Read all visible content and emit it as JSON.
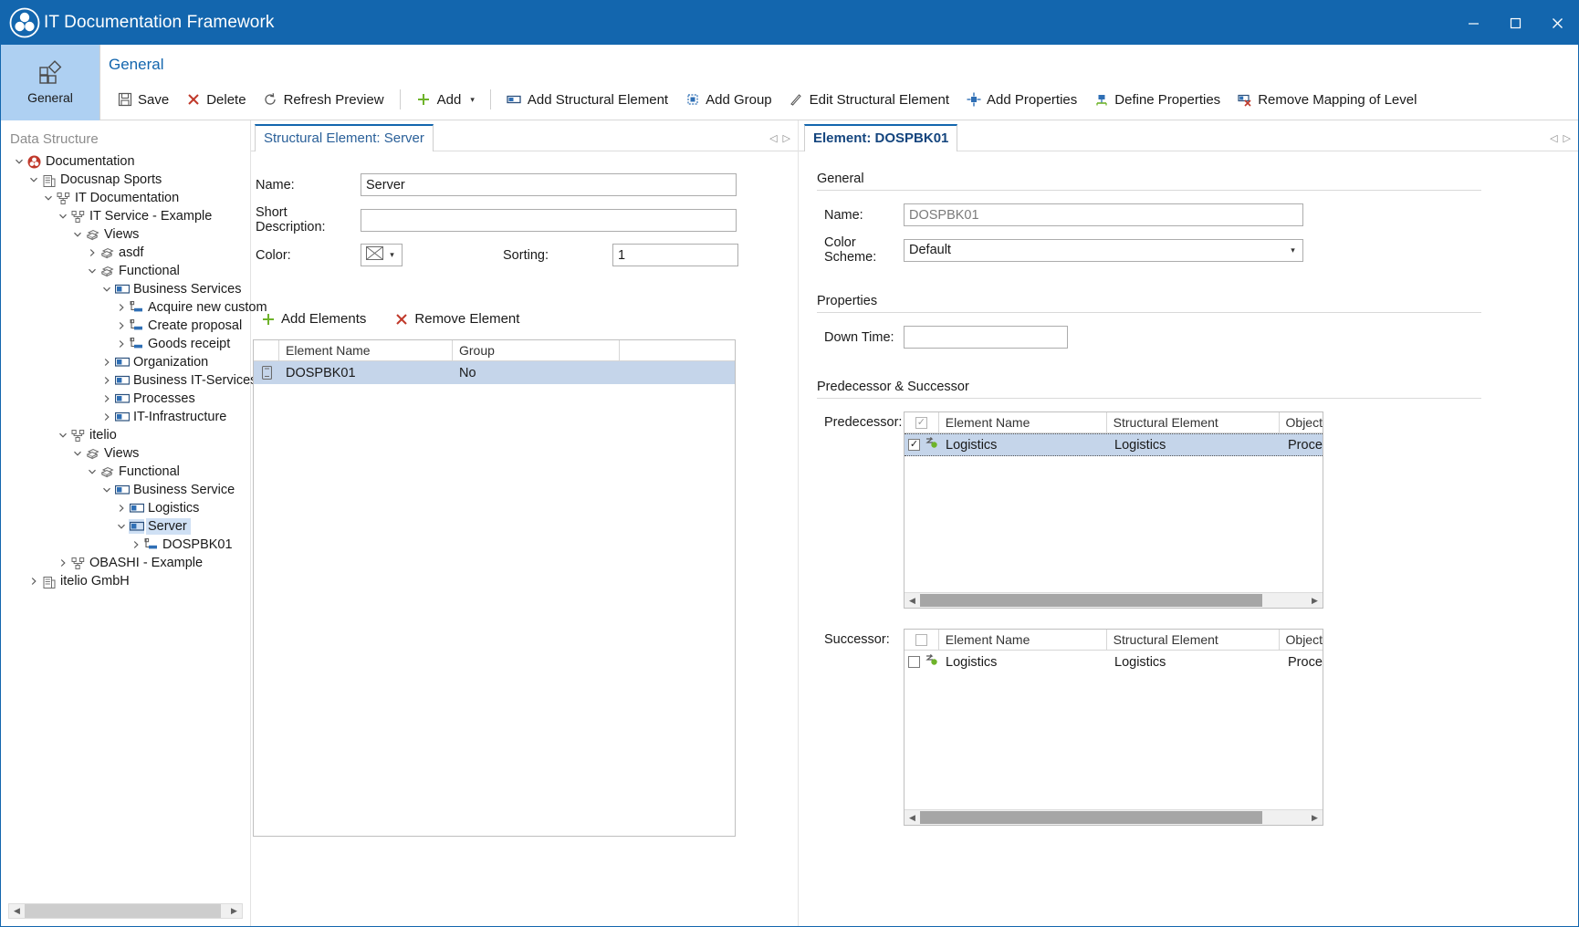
{
  "window": {
    "title": "IT Documentation Framework",
    "minimize": "─",
    "maximize": "☐",
    "close": "✕"
  },
  "nav": {
    "general_tab": "General"
  },
  "ribbon": {
    "title": "General",
    "buttons": [
      {
        "label": "Save",
        "icon": "save-icon"
      },
      {
        "label": "Delete",
        "icon": "delete-x-icon"
      },
      {
        "label": "Refresh Preview",
        "icon": "refresh-icon"
      },
      {
        "label": "Add",
        "icon": "plus-icon",
        "dropdown": "▾"
      },
      {
        "label": "Add Structural Element",
        "icon": "structural-element-icon"
      },
      {
        "label": "Add Group",
        "icon": "group-icon"
      },
      {
        "label": "Edit Structural Element",
        "icon": "pencil-icon"
      },
      {
        "label": "Add Properties",
        "icon": "add-properties-icon"
      },
      {
        "label": "Define Properties",
        "icon": "define-properties-icon"
      },
      {
        "label": "Remove Mapping of Level",
        "icon": "remove-mapping-icon"
      }
    ]
  },
  "left_pane": {
    "caption": "Data Structure",
    "tree": [
      {
        "label": "Documentation",
        "depth": 0,
        "twist": "expanded",
        "icon": "documentation-icon"
      },
      {
        "label": "Docusnap Sports",
        "depth": 1,
        "twist": "expanded",
        "icon": "company-icon"
      },
      {
        "label": "IT Documentation",
        "depth": 2,
        "twist": "expanded",
        "icon": "hierarchy-icon"
      },
      {
        "label": "IT Service - Example",
        "depth": 3,
        "twist": "expanded",
        "icon": "hierarchy-icon"
      },
      {
        "label": "Views",
        "depth": 4,
        "twist": "expanded",
        "icon": "view-icon"
      },
      {
        "label": "asdf",
        "depth": 5,
        "twist": "collapsed",
        "icon": "view-icon"
      },
      {
        "label": "Functional",
        "depth": 5,
        "twist": "expanded",
        "icon": "view-icon"
      },
      {
        "label": "Business Services",
        "depth": 6,
        "twist": "expanded",
        "icon": "structural-element-icon"
      },
      {
        "label": "Acquire new custom",
        "depth": 7,
        "twist": "collapsed",
        "icon": "element-icon"
      },
      {
        "label": "Create proposal",
        "depth": 7,
        "twist": "collapsed",
        "icon": "element-icon"
      },
      {
        "label": "Goods receipt",
        "depth": 7,
        "twist": "collapsed",
        "icon": "element-icon"
      },
      {
        "label": "Organization",
        "depth": 6,
        "twist": "collapsed",
        "icon": "structural-element-icon"
      },
      {
        "label": "Business IT-Services",
        "depth": 6,
        "twist": "collapsed",
        "icon": "structural-element-icon"
      },
      {
        "label": "Processes",
        "depth": 6,
        "twist": "collapsed",
        "icon": "structural-element-icon"
      },
      {
        "label": "IT-Infrastructure",
        "depth": 6,
        "twist": "collapsed",
        "icon": "structural-element-icon"
      },
      {
        "label": "itelio",
        "depth": 3,
        "twist": "expanded",
        "icon": "hierarchy-icon"
      },
      {
        "label": "Views",
        "depth": 4,
        "twist": "expanded",
        "icon": "view-icon"
      },
      {
        "label": "Functional",
        "depth": 5,
        "twist": "expanded",
        "icon": "view-icon"
      },
      {
        "label": "Business Service",
        "depth": 6,
        "twist": "expanded",
        "icon": "structural-element-icon"
      },
      {
        "label": "Logistics",
        "depth": 7,
        "twist": "collapsed",
        "icon": "structural-element-icon"
      },
      {
        "label": "Server",
        "depth": 7,
        "twist": "expanded",
        "icon": "structural-element-icon",
        "selected": true
      },
      {
        "label": "DOSPBK01",
        "depth": 8,
        "twist": "collapsed",
        "icon": "element-icon"
      },
      {
        "label": "OBASHI - Example",
        "depth": 3,
        "twist": "collapsed",
        "icon": "hierarchy-icon"
      },
      {
        "label": "itelio GmbH",
        "depth": 1,
        "twist": "collapsed",
        "icon": "company-icon"
      }
    ]
  },
  "center_pane": {
    "tab_label": "Structural Element: Server",
    "nav_prev": "◁",
    "nav_next": "▷",
    "fields": {
      "name_label": "Name:",
      "name_value": "Server",
      "short_description_label": "Short Description:",
      "short_description_value": "",
      "color_label": "Color:",
      "color_value": "",
      "color_dropdown": "▾",
      "sorting_label": "Sorting:",
      "sorting_value": "1"
    },
    "toolbar": [
      {
        "label": "Add Elements",
        "icon": "plus-icon"
      },
      {
        "label": "Remove Element",
        "icon": "delete-x-icon"
      }
    ],
    "grid": {
      "columns": [
        "",
        "Element Name",
        "Group",
        ""
      ],
      "rows": [
        {
          "icon": "device-icon",
          "element_name": "DOSPBK01",
          "group": "No",
          "extra": "",
          "selected": true
        }
      ]
    },
    "hscroll": {
      "left_arrow": "◀",
      "right_arrow": "▶"
    }
  },
  "right_pane": {
    "tab_label": "Element: DOSPBK01",
    "nav_prev": "◁",
    "nav_next": "▷",
    "general_section": "General",
    "name_label": "Name:",
    "name_value": "DOSPBK01",
    "color_scheme_label": "Color Scheme:",
    "color_scheme_value": "Default",
    "color_scheme_caret": "▾",
    "properties_section": "Properties",
    "down_time_label": "Down Time:",
    "down_time_value": "",
    "predsucc_section": "Predecessor & Successor",
    "predecessor_label": "Predecessor:",
    "successor_label": "Successor:",
    "grid_columns": [
      "Element Name",
      "Structural Element",
      "Object"
    ],
    "predecessor_rows": [
      {
        "checked": true,
        "icon": "link-node-icon",
        "element_name": "Logistics",
        "structural_element": "Logistics",
        "object": "Proce"
      }
    ],
    "successor_rows": [
      {
        "checked": false,
        "icon": "link-node-icon",
        "element_name": "Logistics",
        "structural_element": "Logistics",
        "object": "Proce"
      }
    ],
    "header_check_pred": "✓",
    "header_check_succ": "",
    "hscroll": {
      "left_arrow": "◀",
      "right_arrow": "▶"
    }
  },
  "colors": {
    "titlebar": "#1366ae",
    "accent": "#1366ae",
    "nav_selected": "#aed0f2",
    "row_selected": "#c5d5ea",
    "tree_selected": "#cfe0f4",
    "green": "#6eb32a",
    "red": "#c0392b"
  }
}
